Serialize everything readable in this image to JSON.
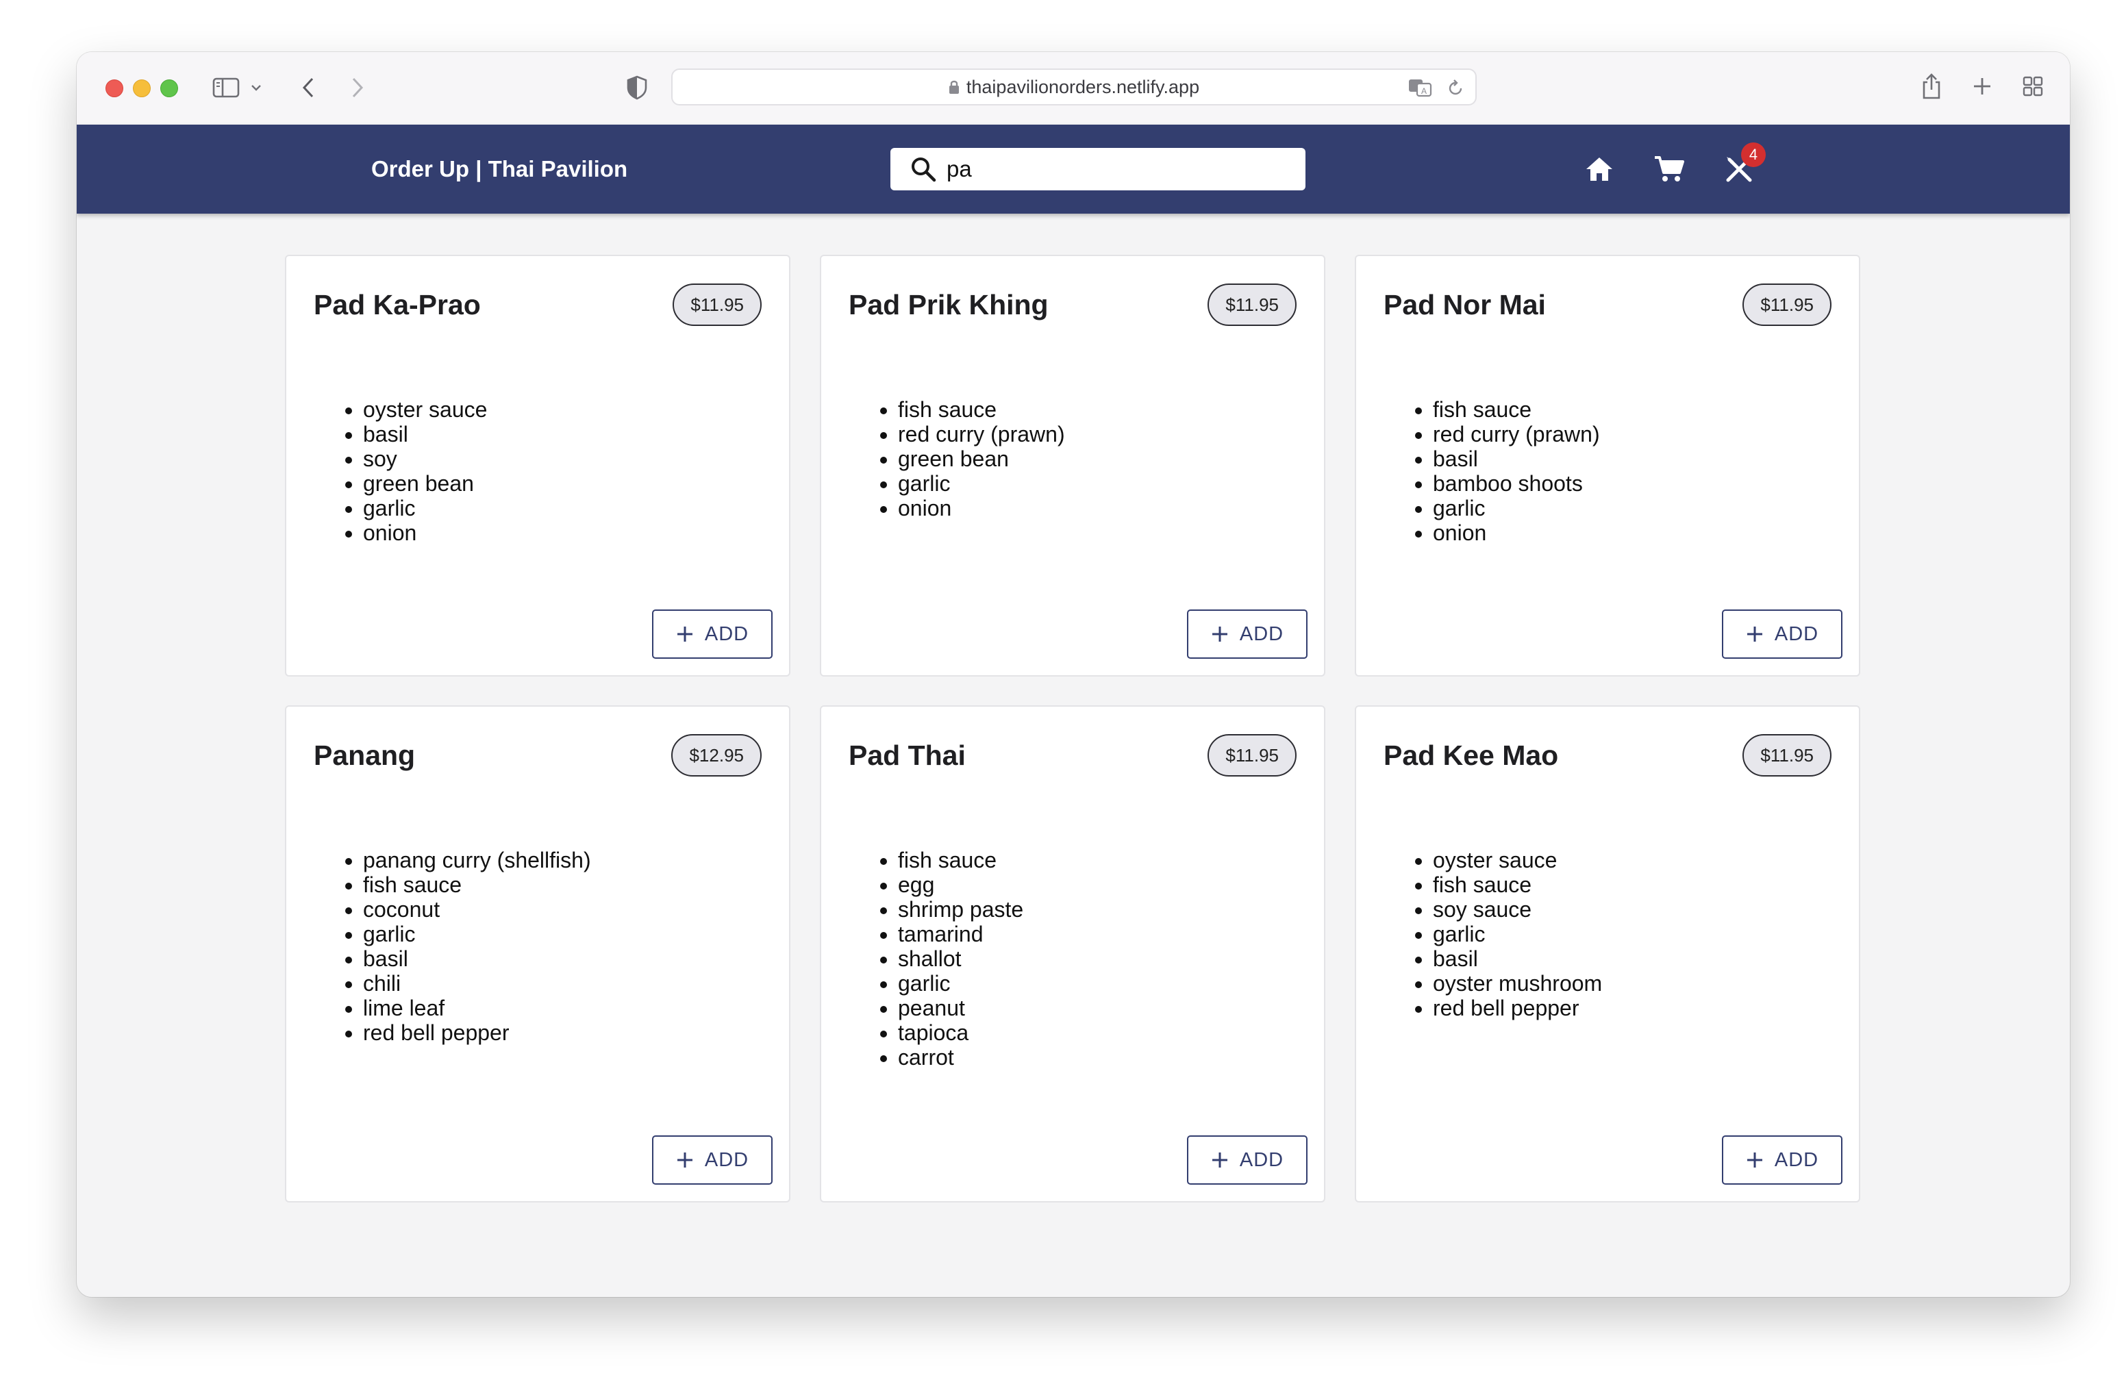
{
  "browser": {
    "url": "thaipavilionorders.netlify.app"
  },
  "header": {
    "brand": "Order Up | Thai Pavilion",
    "search_value": "pa",
    "order_count": "4",
    "bg_color": "#333e6f",
    "icons": [
      "home-icon",
      "cart-icon",
      "utensils-icon"
    ]
  },
  "menu": {
    "add_label": "ADD",
    "items": [
      {
        "name": "Pad Ka-Prao",
        "price": "$11.95",
        "ingredients": [
          "oyster sauce",
          "basil",
          "soy",
          "green bean",
          "garlic",
          "onion"
        ]
      },
      {
        "name": "Pad Prik Khing",
        "price": "$11.95",
        "ingredients": [
          "fish sauce",
          "red curry (prawn)",
          "green bean",
          "garlic",
          "onion"
        ]
      },
      {
        "name": "Pad Nor Mai",
        "price": "$11.95",
        "ingredients": [
          "fish sauce",
          "red curry (prawn)",
          "basil",
          "bamboo shoots",
          "garlic",
          "onion"
        ]
      },
      {
        "name": "Panang",
        "price": "$12.95",
        "ingredients": [
          "panang curry (shellfish)",
          "fish sauce",
          "coconut",
          "garlic",
          "basil",
          "chili",
          "lime leaf",
          "red bell pepper"
        ]
      },
      {
        "name": "Pad Thai",
        "price": "$11.95",
        "ingredients": [
          "fish sauce",
          "egg",
          "shrimp paste",
          "tamarind",
          "shallot",
          "garlic",
          "peanut",
          "tapioca",
          "carrot"
        ]
      },
      {
        "name": "Pad Kee Mao",
        "price": "$11.95",
        "ingredients": [
          "oyster sauce",
          "fish sauce",
          "soy sauce",
          "garlic",
          "basil",
          "oyster mushroom",
          "red bell pepper"
        ]
      }
    ]
  }
}
